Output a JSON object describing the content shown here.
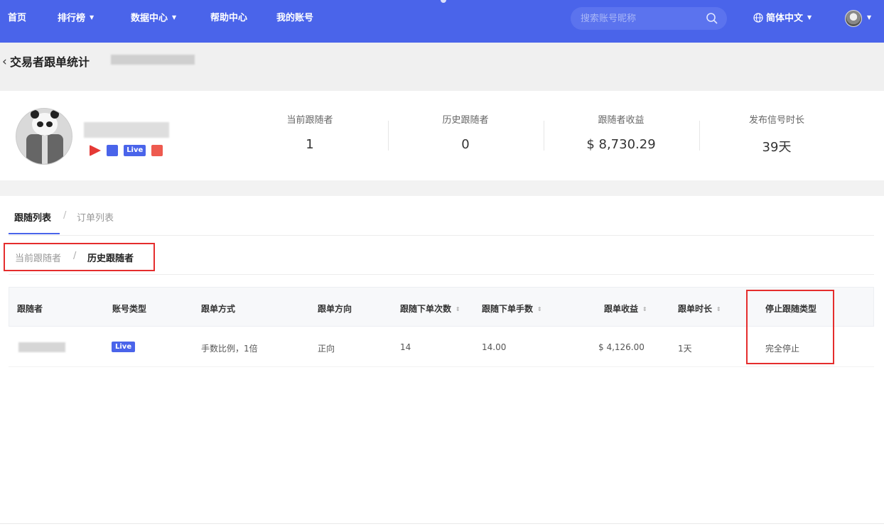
{
  "nav": {
    "items": [
      {
        "label": "首页",
        "has_caret": false
      },
      {
        "label": "排行榜",
        "has_caret": true
      },
      {
        "label": "数据中心",
        "has_caret": true
      },
      {
        "label": "帮助中心",
        "has_caret": false
      },
      {
        "label": "我的账号",
        "has_caret": false
      }
    ],
    "search_placeholder": "搜索账号昵称",
    "language": "简体中文",
    "caret": "▼"
  },
  "page": {
    "back_icon": "‹",
    "title": "交易者跟单统计"
  },
  "profile": {
    "badges": {
      "live": "Live"
    },
    "stats": [
      {
        "label": "当前跟随者",
        "value": "1"
      },
      {
        "label": "历史跟随者",
        "value": "0"
      },
      {
        "label": "跟随者收益",
        "value": "$ 8,730.29"
      },
      {
        "label": "发布信号时长",
        "value": "39天"
      }
    ]
  },
  "tabs": {
    "active": "跟随列表",
    "inactive": "订单列表",
    "separator": "/"
  },
  "subtabs": {
    "inactive": "当前跟随者",
    "active": "历史跟随者",
    "separator": "/"
  },
  "table": {
    "columns": [
      "跟随者",
      "账号类型",
      "跟单方式",
      "跟单方向",
      "跟随下单次数",
      "跟随下单手数",
      "跟单收益",
      "跟单时长",
      "停止跟随类型"
    ],
    "sort_icon": "⇕",
    "rows": [
      {
        "account_type": "Live",
        "mode": "手数比例，1倍",
        "direction": "正向",
        "order_count": "14",
        "lots": "14.00",
        "profit": "$ 4,126.00",
        "duration": "1天",
        "stop_type": "完全停止"
      }
    ]
  },
  "colors": {
    "brand": "#4a64ea",
    "highlight_box": "#e52d2d"
  }
}
